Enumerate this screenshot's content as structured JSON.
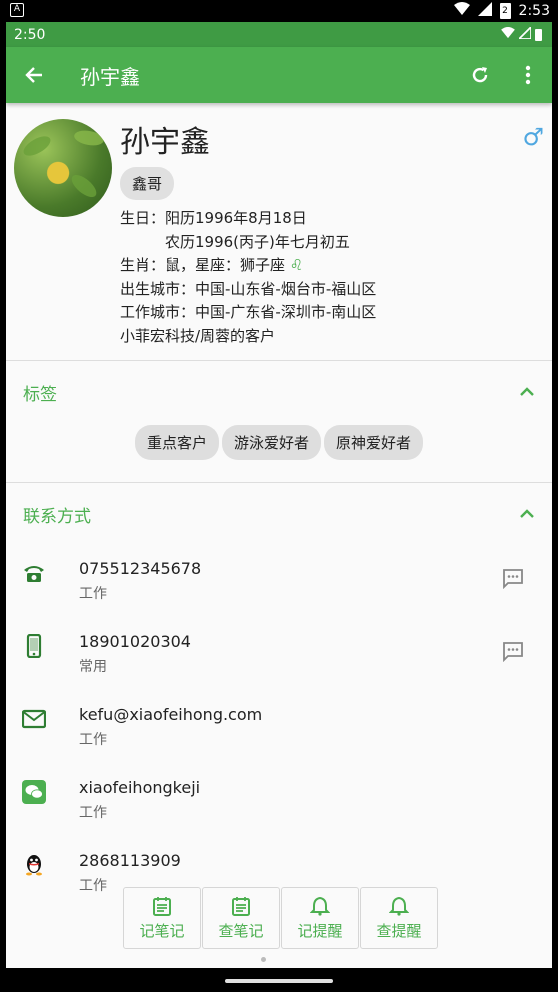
{
  "os_status": {
    "time": "2:53",
    "battery_level_label": "2"
  },
  "app_status": {
    "time": "2:50"
  },
  "toolbar": {
    "title": "孙宇鑫"
  },
  "profile": {
    "name": "孙宇鑫",
    "gender_symbol": "♂",
    "nickname": "鑫哥",
    "birthday_solar": "生日：阳历1996年8月18日",
    "birthday_lunar": "农历1996(丙子)年七月初五",
    "zodiac": "生肖：鼠，星座：狮子座",
    "zodiac_symbol": "♌",
    "birth_city": "出生城市：中国-山东省-烟台市-福山区",
    "work_city": "工作城市：中国-广东省-深圳市-南山区",
    "owner": "小菲宏科技/周蓉的客户"
  },
  "tags_section": {
    "title": "标签",
    "tags": [
      "重点客户",
      "游泳爱好者",
      "原神爱好者"
    ]
  },
  "contact_section": {
    "title": "联系方式",
    "items": [
      {
        "icon": "telephone-icon",
        "value": "075512345678",
        "label": "工作",
        "has_message": true
      },
      {
        "icon": "mobile-phone-icon",
        "value": "18901020304",
        "label": "常用",
        "has_message": true
      },
      {
        "icon": "email-icon",
        "value": "kefu@xiaofeihong.com",
        "label": "工作",
        "has_message": false
      },
      {
        "icon": "wechat-icon",
        "value": "xiaofeihongkeji",
        "label": "工作",
        "has_message": false
      },
      {
        "icon": "qq-icon",
        "value": "2868113909",
        "label": "工作",
        "has_message": false
      }
    ]
  },
  "bottom_actions": [
    {
      "icon": "calendar-note-icon",
      "label": "记笔记"
    },
    {
      "icon": "calendar-note-icon",
      "label": "查笔记"
    },
    {
      "icon": "bell-icon",
      "label": "记提醒"
    },
    {
      "icon": "bell-icon",
      "label": "查提醒"
    }
  ],
  "colors": {
    "primary": "#4caf50",
    "primary_dark": "#3f9b44",
    "gender": "#4fa7e0"
  }
}
